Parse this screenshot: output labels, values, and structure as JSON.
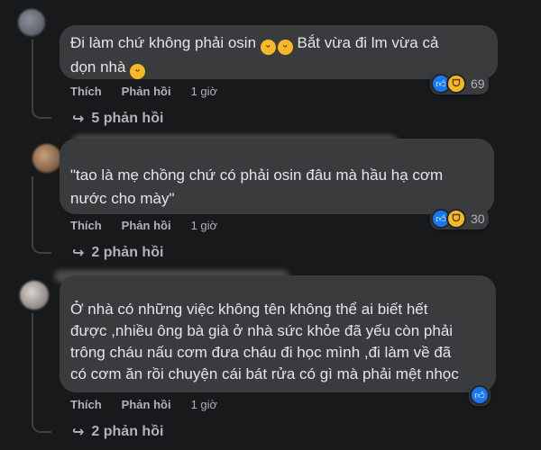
{
  "comments": [
    {
      "text_line1": "Đi làm chứ không phải osin",
      "text_line1_after": "Bắt vừa đi lm vừa cả",
      "text_line2": "dọn nhà",
      "like_label": "Thích",
      "reply_label": "Phản hồi",
      "time": "1 giờ",
      "reaction_count": "69",
      "replies": "5 phản hồi"
    },
    {
      "text": "\"tao là mẹ chồng chứ có phải osin đâu mà hầu hạ cơm\nnước cho mày\"",
      "like_label": "Thích",
      "reply_label": "Phản hồi",
      "time": "1 giờ",
      "reaction_count": "30",
      "replies": "2 phản hồi"
    },
    {
      "text": "Ở nhà có những việc không tên không thể ai biết hết\nđược ,nhiều ông bà già ở nhà sức khỏe đã yếu còn phải\ntrông cháu nấu cơm đưa cháu đi học mình ,đi làm về đã\ncó cơm ăn rồi chuyện cái bát rửa có gì mà phải mệt nhọc",
      "like_label": "Thích",
      "reply_label": "Phản hồi",
      "time": "1 giờ",
      "replies": "2 phản hồi"
    }
  ],
  "icons": {
    "like": "thumbs-up-icon",
    "haha": "haha-face-icon",
    "reply_arrow": "reply-arrow-icon",
    "smile": "smile-emoji-icon"
  },
  "colors": {
    "background": "#18191a",
    "bubble": "#3a3b3c",
    "text": "#e4e6eb",
    "muted": "#b0b3b8",
    "like_blue": "#1877f2",
    "haha_yellow": "#f7b928"
  }
}
